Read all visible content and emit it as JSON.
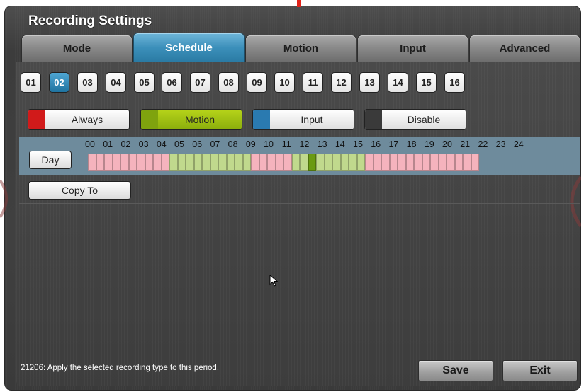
{
  "window": {
    "title": "Recording Settings"
  },
  "tabs": [
    {
      "label": "Mode",
      "active": false
    },
    {
      "label": "Schedule",
      "active": true
    },
    {
      "label": "Motion",
      "active": false
    },
    {
      "label": "Input",
      "active": false
    },
    {
      "label": "Advanced",
      "active": false
    }
  ],
  "channels": {
    "items": [
      "01",
      "02",
      "03",
      "04",
      "05",
      "06",
      "07",
      "08",
      "09",
      "10",
      "11",
      "12",
      "13",
      "14",
      "15",
      "16"
    ],
    "selected": "02"
  },
  "record_types": [
    {
      "label": "Always",
      "color": "#d11a1a",
      "selected": false
    },
    {
      "label": "Motion",
      "color": "#7fa30e",
      "selected": true
    },
    {
      "label": "Input",
      "color": "#2a7ab0",
      "selected": false
    },
    {
      "label": "Disable",
      "color": "#3a3a3a",
      "selected": false
    }
  ],
  "schedule": {
    "day_label": "Day",
    "hour_labels": [
      "00",
      "01",
      "02",
      "03",
      "04",
      "05",
      "06",
      "07",
      "08",
      "09",
      "10",
      "11",
      "12",
      "13",
      "14",
      "15",
      "16",
      "17",
      "18",
      "19",
      "20",
      "21",
      "22",
      "23",
      "24"
    ],
    "cell_count": 48,
    "motion_ranges": [
      [
        10,
        19
      ],
      [
        25,
        33
      ]
    ],
    "cursor_cell": 27,
    "colors": {
      "always": "#f5b3bd",
      "motion": "#c0d98d",
      "cursor": "#6a9a12"
    }
  },
  "copy_label": "Copy To",
  "status_text": "21206: Apply the selected recording type to this period.",
  "buttons": {
    "save": "Save",
    "exit": "Exit"
  },
  "icons": {
    "pointer": "mouse-pointer-icon"
  }
}
